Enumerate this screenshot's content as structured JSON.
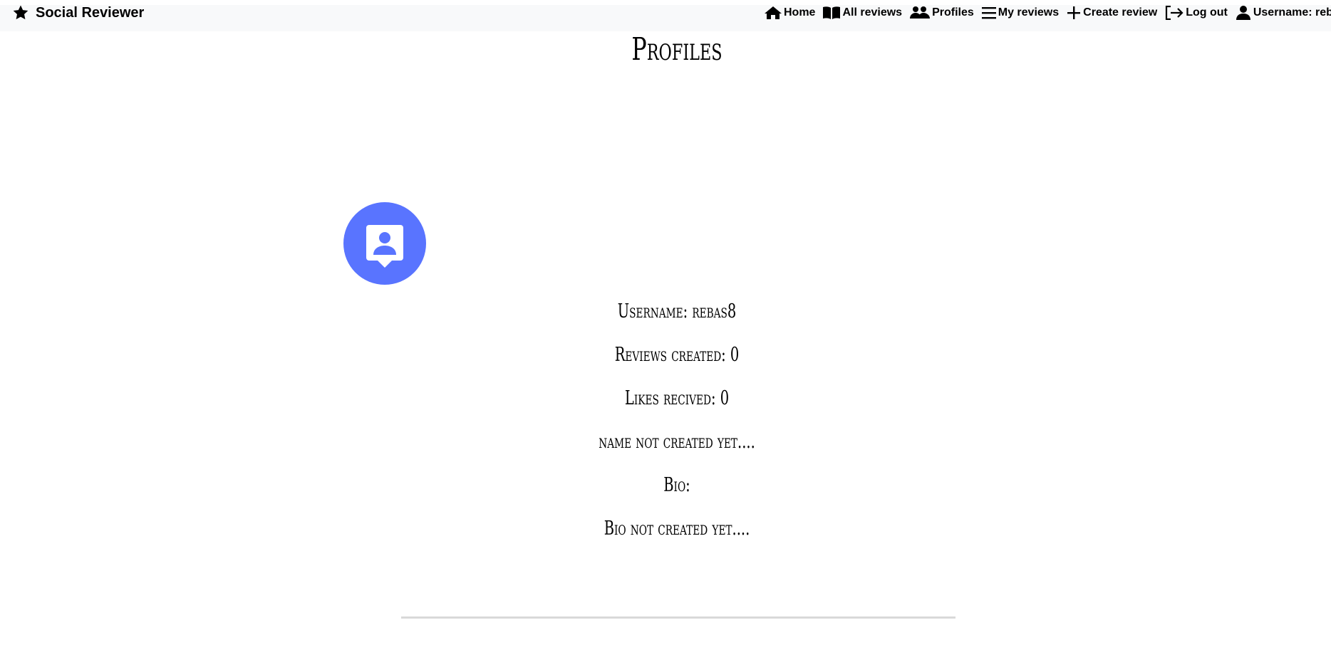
{
  "brand": {
    "name": "Social Reviewer",
    "icon": "star-icon"
  },
  "nav": {
    "items": [
      {
        "label": "Home",
        "icon": "home-icon"
      },
      {
        "label": "All reviews",
        "icon": "book-icon"
      },
      {
        "label": "Profiles",
        "icon": "users-icon"
      },
      {
        "label": "My reviews",
        "icon": "list-icon"
      },
      {
        "label": "Create review",
        "icon": "plus-icon"
      },
      {
        "label": "Log out",
        "icon": "logout-icon"
      },
      {
        "label": "Username: reba",
        "icon": "user-icon"
      }
    ]
  },
  "page": {
    "title": "Profiles"
  },
  "profile": {
    "avatar_icon": "contact-page-icon",
    "avatar_color": "#5974ff",
    "username": "Username: rebas8",
    "reviews_created": "Reviews created: 0",
    "likes_received": "Likes recived: 0",
    "name": "name not created yet....",
    "bio_label": "Bio:",
    "bio": "Bio not created yet...."
  }
}
